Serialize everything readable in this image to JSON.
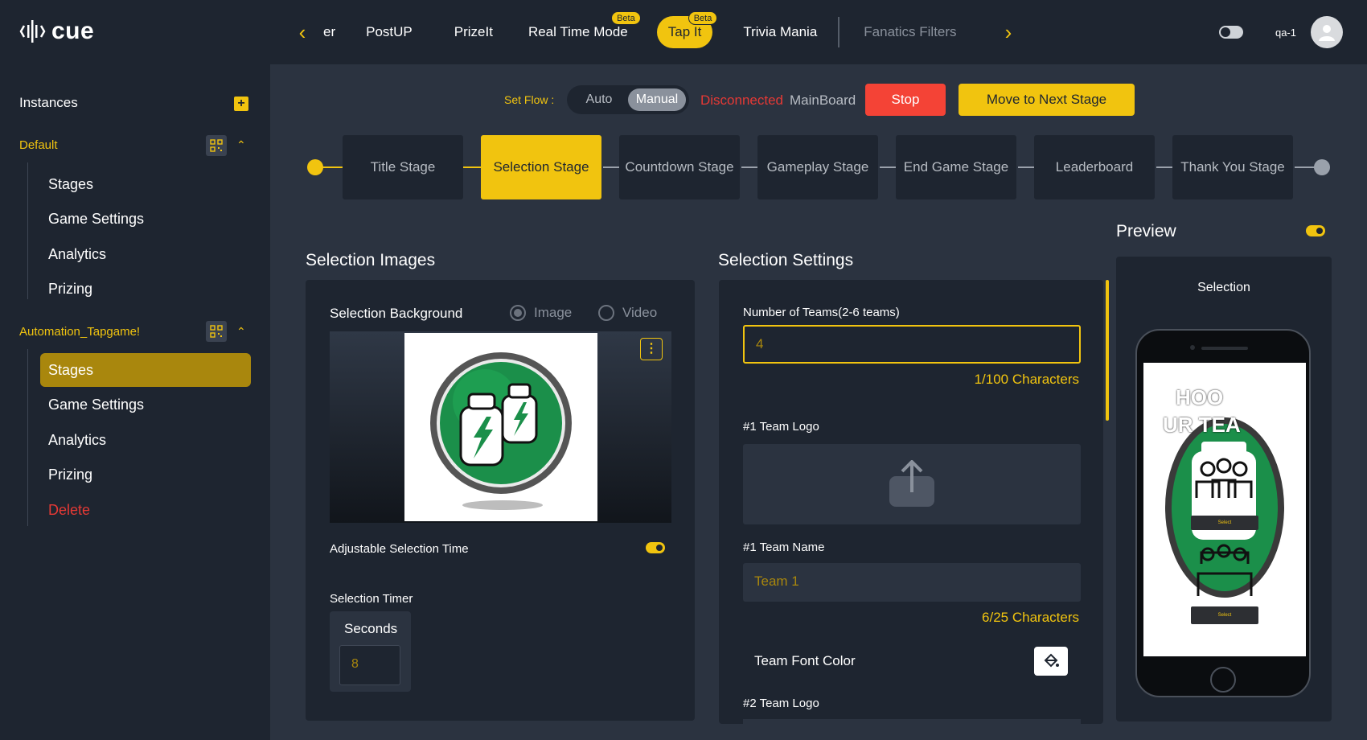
{
  "app": {
    "logo_text": "cue"
  },
  "topbar": {
    "tabs": [
      {
        "label": "er",
        "beta": ""
      },
      {
        "label": "PostUP",
        "beta": ""
      },
      {
        "label": "PrizeIt",
        "beta": ""
      },
      {
        "label": "Real Time Mode",
        "beta": "Beta"
      },
      {
        "label": "Tap It",
        "beta": "Beta"
      },
      {
        "label": "Trivia Mania",
        "beta": ""
      },
      {
        "label": "Fanatics Filters",
        "beta": ""
      }
    ],
    "user": "qa-1"
  },
  "sidebar": {
    "title": "Instances",
    "groups": [
      {
        "name": "Default",
        "items": [
          "Stages",
          "Game Settings",
          "Analytics",
          "Prizing"
        ]
      },
      {
        "name": "Automation_Tapgame!",
        "items": [
          "Stages",
          "Game Settings",
          "Analytics",
          "Prizing",
          "Delete"
        ]
      }
    ]
  },
  "flow": {
    "label": "Set Flow :",
    "options": [
      "Auto",
      "Manual"
    ],
    "selected": "Manual",
    "status": "Disconnected",
    "board": "MainBoard",
    "stop_label": "Stop",
    "next_label": "Move to Next Stage"
  },
  "stages": [
    "Title Stage",
    "Selection Stage",
    "Countdown Stage",
    "Gameplay Stage",
    "End Game Stage",
    "Leaderboard",
    "Thank You Stage"
  ],
  "selection_images": {
    "title": "Selection Images",
    "background_label": "Selection Background",
    "media_options": [
      "Image",
      "Video"
    ],
    "adjustable_label": "Adjustable Selection Time",
    "timer_label": "Selection Timer",
    "seconds_label": "Seconds",
    "seconds_value": "8"
  },
  "selection_settings": {
    "title": "Selection Settings",
    "teams_label": "Number of Teams(2-6 teams)",
    "teams_value": "4",
    "teams_count": "1/100 Characters",
    "team1_logo_label": "#1 Team Logo",
    "team1_name_label": "#1 Team Name",
    "team1_name_placeholder": "Team 1",
    "team1_name_count": "6/25 Characters",
    "font_color_label": "Team Font Color",
    "team2_logo_label": "#2 Team Logo"
  },
  "preview": {
    "title": "Preview",
    "screen_title": "Selection",
    "overlay_text_1": "HOO",
    "overlay_text_2": "UR TEA",
    "button_label": "Select"
  },
  "colors": {
    "accent": "#f1c40f",
    "bg": "#2b3340",
    "panel": "#1e2530",
    "danger": "#f44336"
  }
}
